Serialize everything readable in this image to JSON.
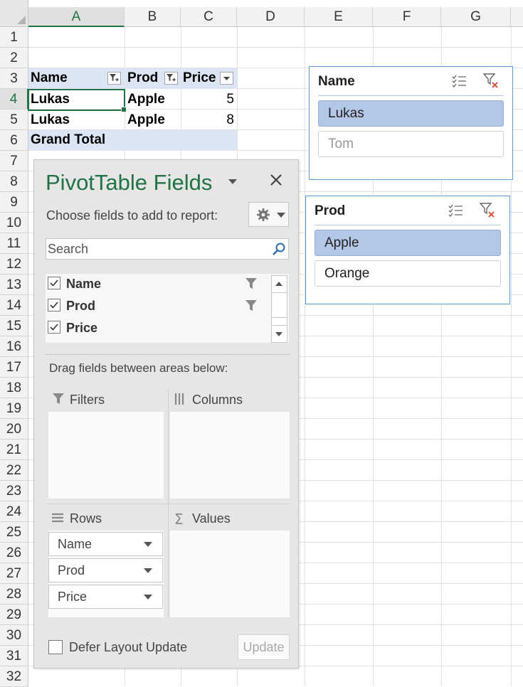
{
  "columns": [
    "A",
    "B",
    "C",
    "D",
    "E",
    "F",
    "G"
  ],
  "rows": [
    "1",
    "2",
    "3",
    "4",
    "5",
    "6",
    "7",
    "8",
    "9",
    "10",
    "11",
    "12",
    "13",
    "14",
    "15",
    "16",
    "17",
    "18",
    "19",
    "20",
    "21",
    "22",
    "23",
    "24",
    "25",
    "26",
    "27",
    "28",
    "29",
    "30",
    "31",
    "32"
  ],
  "pivot": {
    "headers": [
      "Name",
      "Prod",
      "Price"
    ],
    "data_rows": [
      {
        "name": "Lukas",
        "prod": "Apple",
        "price": "5"
      },
      {
        "name": "Lukas",
        "prod": "Apple",
        "price": "8"
      }
    ],
    "grand_total": "Grand Total"
  },
  "slicers": [
    {
      "title": "Name",
      "items": [
        {
          "label": "Lukas",
          "state": "selected"
        },
        {
          "label": "Tom",
          "state": "no-data"
        }
      ]
    },
    {
      "title": "Prod",
      "items": [
        {
          "label": "Apple",
          "state": "selected"
        },
        {
          "label": "Orange",
          "state": "unselected"
        }
      ]
    }
  ],
  "field_pane": {
    "title": "PivotTable Fields",
    "choose_label": "Choose fields to add to report:",
    "search_placeholder": "Search",
    "fields": [
      {
        "label": "Name",
        "checked": true,
        "filtered": true
      },
      {
        "label": "Prod",
        "checked": true,
        "filtered": true
      },
      {
        "label": "Price",
        "checked": true,
        "filtered": false
      }
    ],
    "drag_hint": "Drag fields between areas below:",
    "areas": {
      "filters": "Filters",
      "columns": "Columns",
      "rows": "Rows",
      "values": "Values"
    },
    "row_fields": [
      "Name",
      "Prod",
      "Price"
    ],
    "defer_label": "Defer Layout Update",
    "update_label": "Update"
  },
  "colors": {
    "accent": "#217346",
    "pivot_header": "#dbe5f3",
    "slicer_selected": "#b4c7e7",
    "slicer_border": "#5b9bd5"
  }
}
